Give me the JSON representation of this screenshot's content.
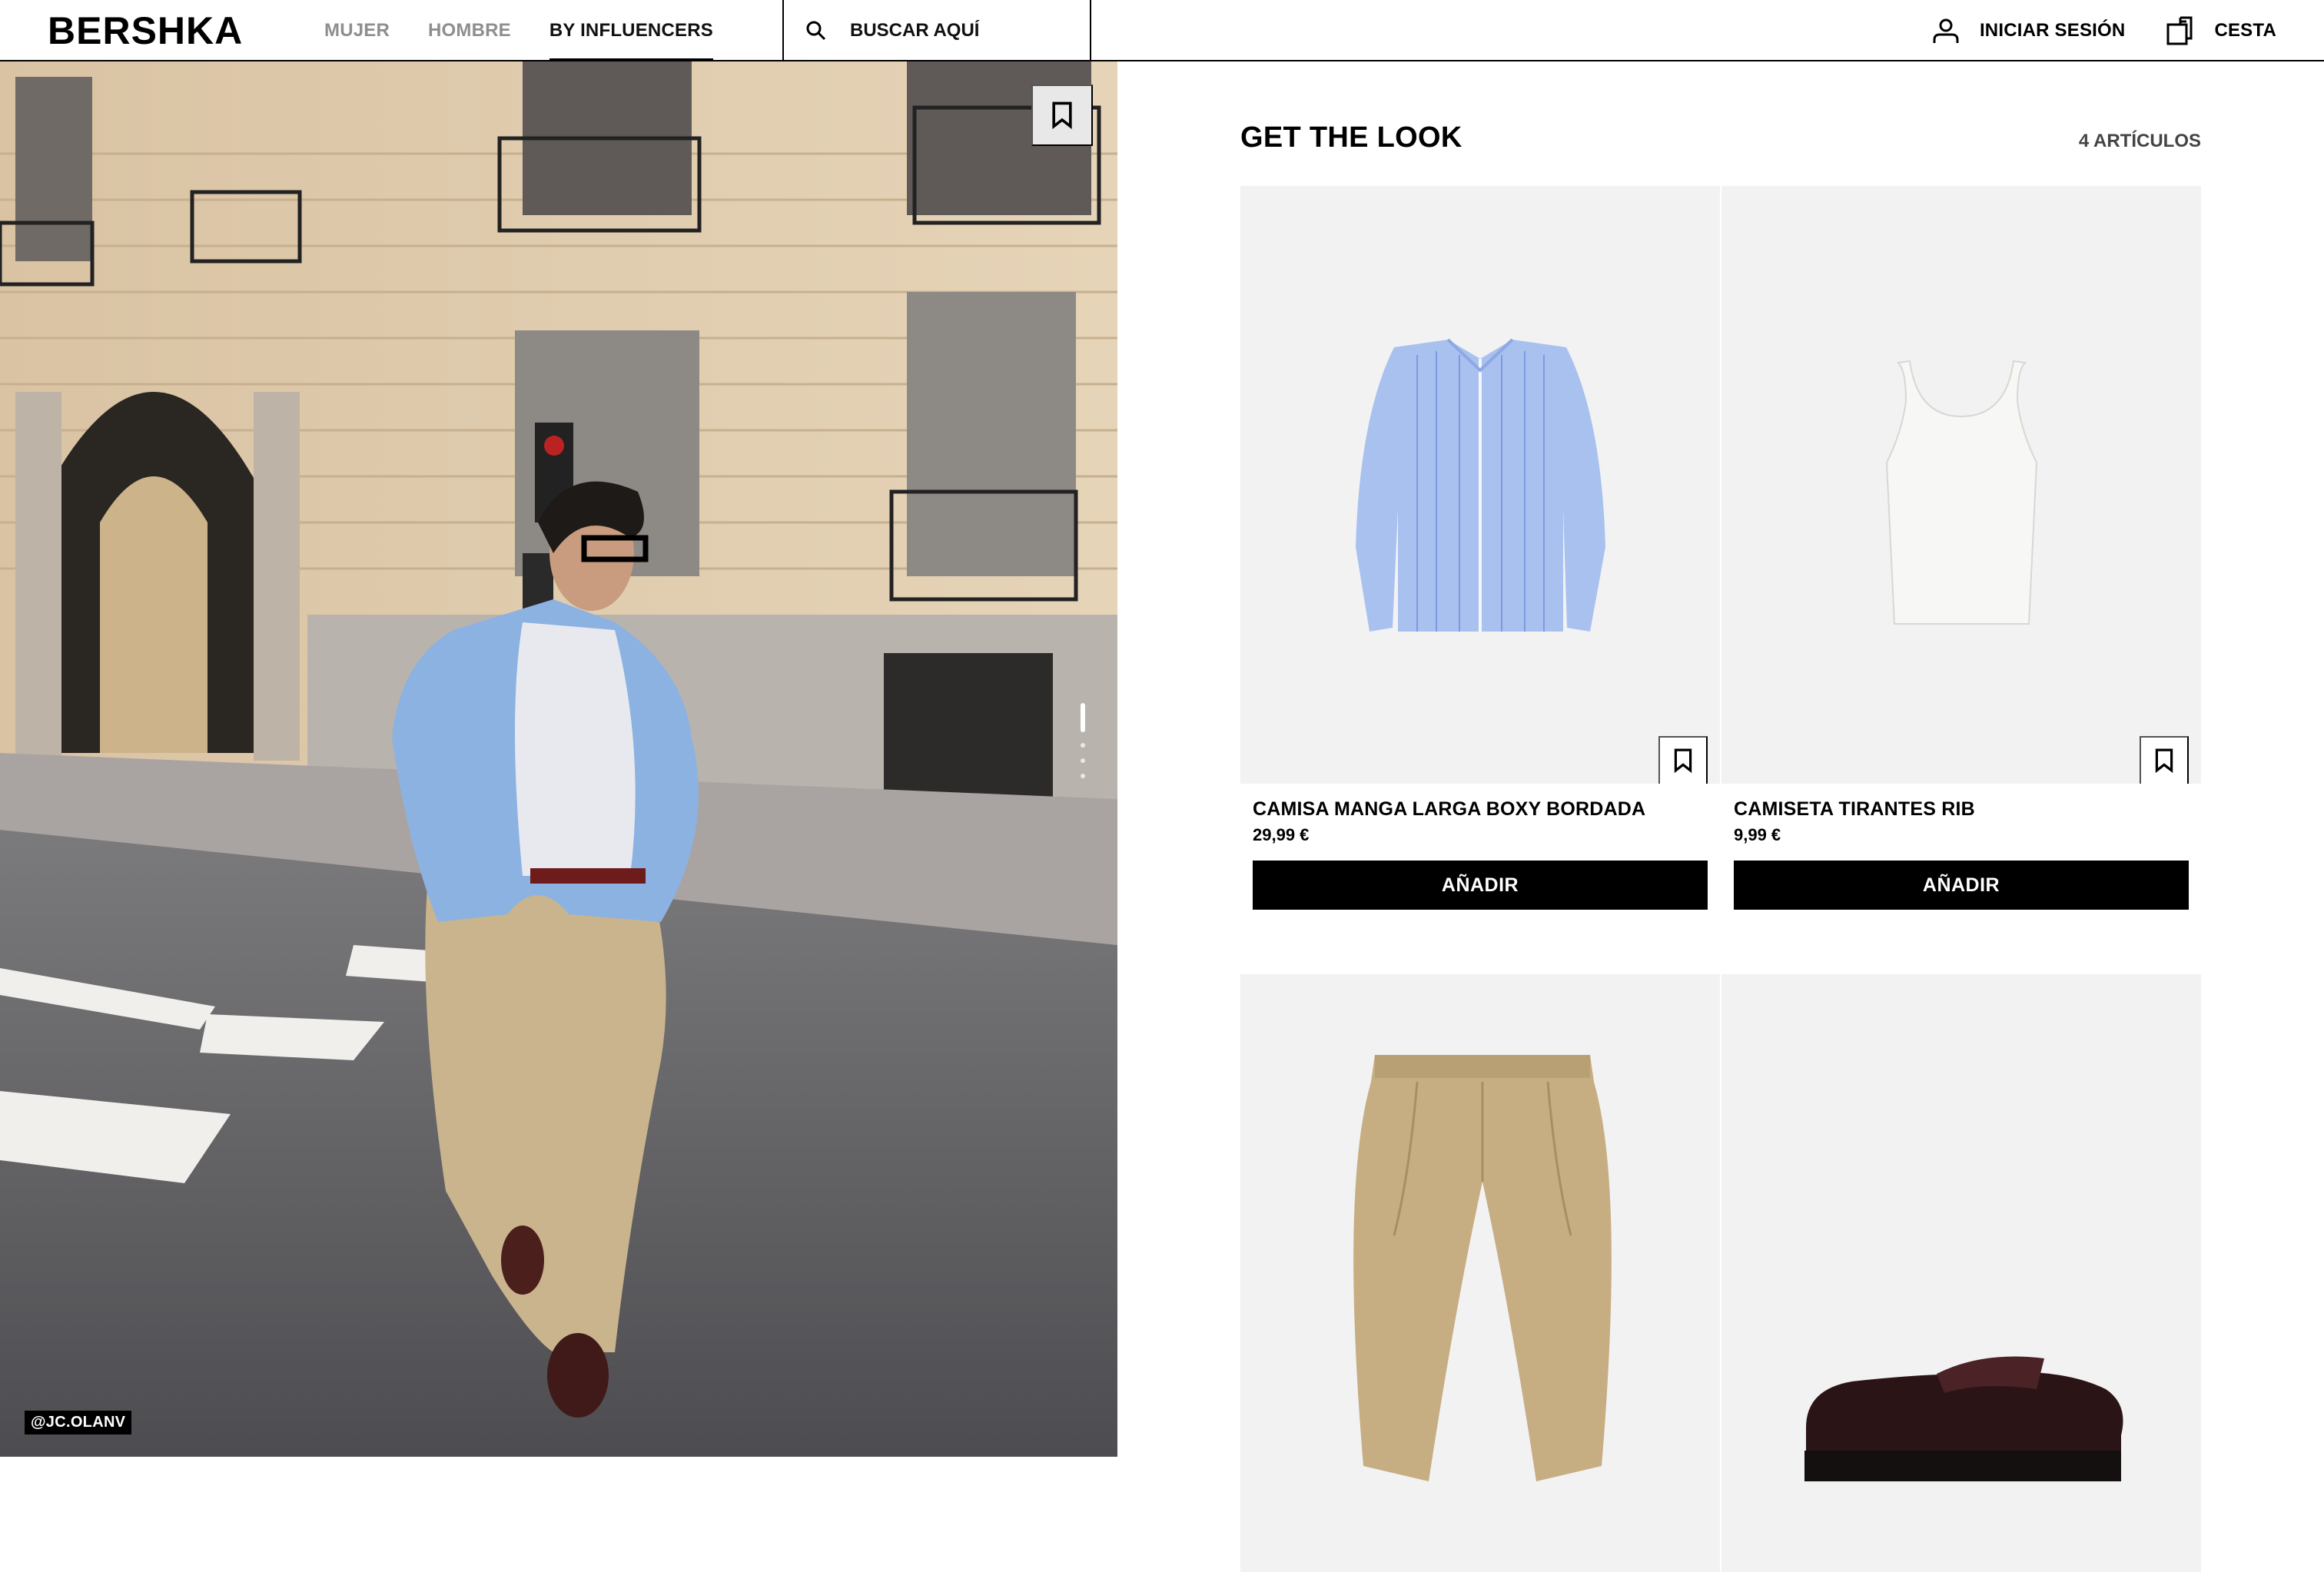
{
  "header": {
    "logo": "BERSHKA",
    "nav": [
      {
        "label": "MUJER",
        "active": false
      },
      {
        "label": "HOMBRE",
        "active": false
      },
      {
        "label": "BY INFLUENCERS",
        "active": true
      }
    ],
    "search_placeholder": "BUSCAR AQUÍ",
    "login_label": "INICIAR SESIÓN",
    "cart_label": "CESTA"
  },
  "photo": {
    "credit": "@JC.OLANV",
    "slides": 4,
    "current_slide": 1
  },
  "panel": {
    "title": "GET THE LOOK",
    "count": "4 ARTÍCULOS",
    "products": [
      {
        "name": "CAMISA MANGA LARGA BOXY BORDADA",
        "price": "29,99 €",
        "button": "AÑADIR",
        "icon": "shirt-icon"
      },
      {
        "name": "CAMISETA TIRANTES RIB",
        "price": "9,99 €",
        "button": "AÑADIR",
        "icon": "tank-top-icon"
      },
      {
        "name": "",
        "price": "",
        "button": "",
        "icon": "trousers-icon"
      },
      {
        "name": "",
        "price": "",
        "button": "",
        "icon": "loafer-icon"
      }
    ]
  },
  "colors": {
    "accent": "#000000",
    "card_bg": "#f2f2f3",
    "nav_inactive": "#8e8e8e"
  }
}
